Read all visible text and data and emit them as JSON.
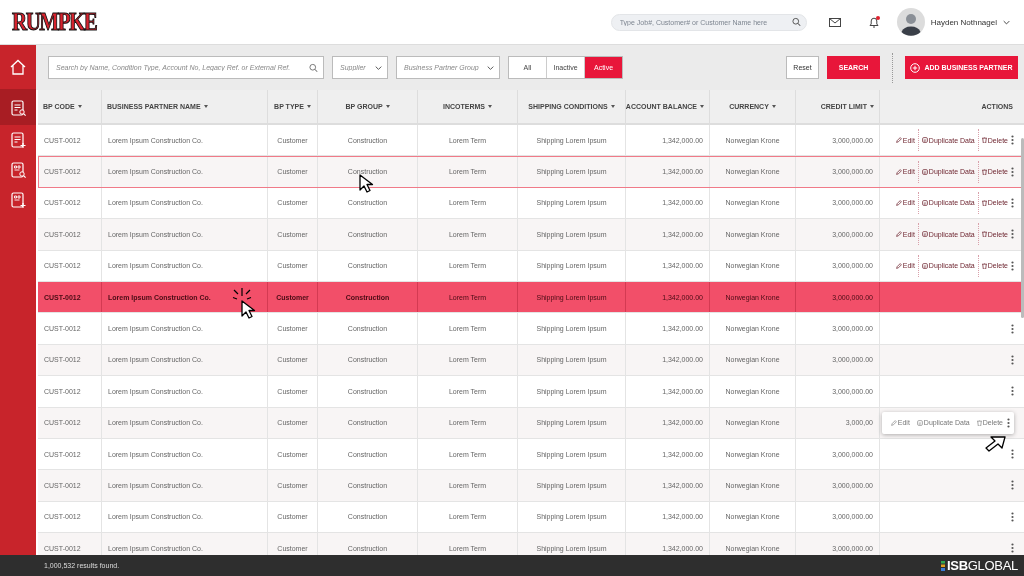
{
  "header": {
    "logo": "RUMPKE",
    "search": {
      "placeholder": "Type Job#, Customer# or Customer Name here"
    },
    "notification": true,
    "user": {
      "name": "Hayden Nothnagel"
    }
  },
  "sidebar": {
    "items": [
      {
        "kind": "home",
        "selected": false
      },
      {
        "kind": "list-search",
        "selected": true
      },
      {
        "kind": "list-add",
        "selected": false
      },
      {
        "kind": "doc-search",
        "selected": false
      },
      {
        "kind": "doc-add",
        "selected": false
      }
    ]
  },
  "filters": {
    "search": {
      "placeholder": "Search by Name, Condition Type, Account No, Legacy Ref. or External Ref."
    },
    "dropdowns": [
      {
        "placeholder": "Supplier"
      },
      {
        "placeholder": "Business Partner Group"
      }
    ],
    "status_tabs": [
      {
        "label": "All",
        "selected": false
      },
      {
        "label": "Inactive",
        "selected": false
      },
      {
        "label": "Active",
        "selected": true
      }
    ],
    "buttons": [
      {
        "kind": "reset",
        "label": "Reset"
      },
      {
        "kind": "search",
        "label": "SEARCH"
      },
      {
        "kind": "add",
        "label": "ADD BUSINESS PARTNER"
      }
    ]
  },
  "table": {
    "columns": [
      {
        "label": "BP CODE",
        "sortable": true
      },
      {
        "label": "BUSINESS PARTNER NAME",
        "sortable": true
      },
      {
        "label": "BP TYPE",
        "sortable": true
      },
      {
        "label": "BP GROUP",
        "sortable": true
      },
      {
        "label": "INCOTERMS",
        "sortable": true
      },
      {
        "label": "SHIPPING CONDITIONS",
        "sortable": true
      },
      {
        "label": "ACCOUNT BALANCE",
        "sortable": true
      },
      {
        "label": "CURRENCY",
        "sortable": true
      },
      {
        "label": "CREDIT LIMIT",
        "sortable": true
      },
      {
        "label": "ACTIONS",
        "sortable": false
      }
    ],
    "rows": [
      {
        "cells": [
          "CUST-0012",
          "Lorem Ipsum Construction Co.",
          "Customer",
          "Construction",
          "Lorem Term",
          "Shipping Lorem Ipsum",
          "1,342,000.00",
          "Norwegian Krone",
          "3,000,000.00"
        ],
        "selected": false,
        "hovered": false,
        "kind": "inline",
        "actions": [
          "Edit",
          "Duplicate Data",
          "Delete"
        ]
      },
      {
        "cells": [
          "CUST-0012",
          "Lorem Ipsum Construction Co.",
          "Customer",
          "Construction",
          "Lorem Term",
          "Shipping Lorem Ipsum",
          "1,342,000.00",
          "Norwegian Krone",
          "3,000,000.00"
        ],
        "selected": false,
        "hovered": true,
        "kind": "inline",
        "actions": [
          "Edit",
          "Duplicate Data",
          "Delete"
        ]
      },
      {
        "cells": [
          "CUST-0012",
          "Lorem Ipsum Construction Co.",
          "Customer",
          "Construction",
          "Lorem Term",
          "Shipping Lorem Ipsum",
          "1,342,000.00",
          "Norwegian Krone",
          "3,000,000.00"
        ],
        "selected": false,
        "hovered": false,
        "kind": "inline",
        "actions": [
          "Edit",
          "Duplicate Data",
          "Delete"
        ]
      },
      {
        "cells": [
          "CUST-0012",
          "Lorem Ipsum Construction Co.",
          "Customer",
          "Construction",
          "Lorem Term",
          "Shipping Lorem Ipsum",
          "1,342,000.00",
          "Norwegian Krone",
          "3,000,000.00"
        ],
        "selected": false,
        "hovered": false,
        "kind": "inline",
        "actions": [
          "Edit",
          "Duplicate Data",
          "Delete"
        ]
      },
      {
        "cells": [
          "CUST-0012",
          "Lorem Ipsum Construction Co.",
          "Customer",
          "Construction",
          "Lorem Term",
          "Shipping Lorem Ipsum",
          "1,342,000.00",
          "Norwegian Krone",
          "3,000,000.00"
        ],
        "selected": false,
        "hovered": false,
        "kind": "inline",
        "actions": [
          "Edit",
          "Duplicate Data",
          "Delete"
        ]
      },
      {
        "cells": [
          "CUST-0012",
          "Lorem Ipsum Construction Co.",
          "Customer",
          "Construction",
          "Lorem Term",
          "Shipping Lorem Ipsum",
          "1,342,000.00",
          "Norwegian Krone",
          "3,000,000.00"
        ],
        "selected": true,
        "hovered": false,
        "kind": "blank"
      },
      {
        "cells": [
          "CUST-0012",
          "Lorem Ipsum Construction Co.",
          "Customer",
          "Construction",
          "Lorem Term",
          "Shipping Lorem Ipsum",
          "1,342,000.00",
          "Norwegian Krone",
          "3,000,000.00"
        ],
        "selected": false,
        "hovered": false,
        "kind": "menu"
      },
      {
        "cells": [
          "CUST-0012",
          "Lorem Ipsum Construction Co.",
          "Customer",
          "Construction",
          "Lorem Term",
          "Shipping Lorem Ipsum",
          "1,342,000.00",
          "Norwegian Krone",
          "3,000,000.00"
        ],
        "selected": false,
        "hovered": false,
        "kind": "menu"
      },
      {
        "cells": [
          "CUST-0012",
          "Lorem Ipsum Construction Co.",
          "Customer",
          "Construction",
          "Lorem Term",
          "Shipping Lorem Ipsum",
          "1,342,000.00",
          "Norwegian Krone",
          "3,000,000.00"
        ],
        "selected": false,
        "hovered": false,
        "kind": "menu"
      },
      {
        "cells": [
          "CUST-0012",
          "Lorem Ipsum Construction Co.",
          "Customer",
          "Construction",
          "Lorem Term",
          "Shipping Lorem Ipsum",
          "1,342,000.00",
          "Norwegian Krone",
          "3,000,00"
        ],
        "selected": false,
        "hovered": false,
        "kind": "popup",
        "actions": [
          "Edit",
          "Duplicate Data",
          "Delete"
        ]
      },
      {
        "cells": [
          "CUST-0012",
          "Lorem Ipsum Construction Co.",
          "Customer",
          "Construction",
          "Lorem Term",
          "Shipping Lorem Ipsum",
          "1,342,000.00",
          "Norwegian Krone",
          "3,000,000.00"
        ],
        "selected": false,
        "hovered": false,
        "kind": "menu"
      },
      {
        "cells": [
          "CUST-0012",
          "Lorem Ipsum Construction Co.",
          "Customer",
          "Construction",
          "Lorem Term",
          "Shipping Lorem Ipsum",
          "1,342,000.00",
          "Norwegian Krone",
          "3,000,000.00"
        ],
        "selected": false,
        "hovered": false,
        "kind": "menu"
      },
      {
        "cells": [
          "CUST-0012",
          "Lorem Ipsum Construction Co.",
          "Customer",
          "Construction",
          "Lorem Term",
          "Shipping Lorem Ipsum",
          "1,342,000.00",
          "Norwegian Krone",
          "3,000,000.00"
        ],
        "selected": false,
        "hovered": false,
        "kind": "menu"
      },
      {
        "cells": [
          "CUST-0012",
          "Lorem Ipsum Construction Co.",
          "Customer",
          "Construction",
          "Lorem Term",
          "Shipping Lorem Ipsum",
          "1,342,000.00",
          "Norwegian Krone",
          "3,000,000.00"
        ],
        "selected": false,
        "hovered": false,
        "kind": "menu"
      }
    ]
  },
  "status_bar": {
    "results": "1,000,532 results found.",
    "brand": "**ISB**GLOBAL"
  }
}
